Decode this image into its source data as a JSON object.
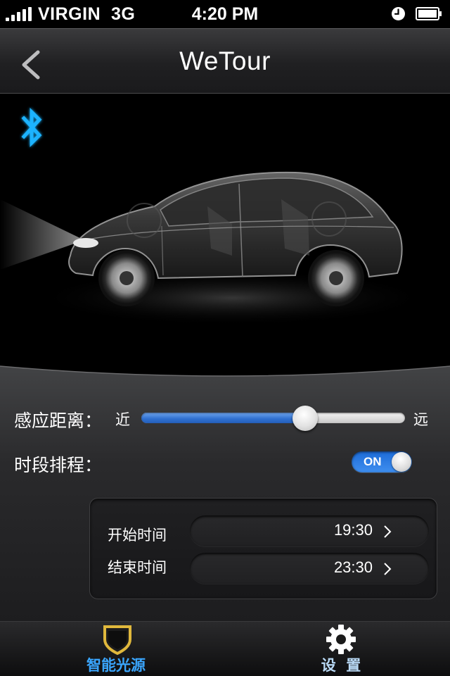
{
  "status_bar": {
    "carrier": "VIRGIN  3G",
    "time": "4:20 PM"
  },
  "nav": {
    "title": "WeTour",
    "back_icon": "chevron-left-icon"
  },
  "bluetooth_icon": "bluetooth-icon",
  "controls": {
    "sensing_distance": {
      "label": "感应距离：",
      "min_label": "近",
      "max_label": "远",
      "value_fraction": 0.62
    },
    "schedule": {
      "label": "时段排程：",
      "toggle_text": "ON",
      "enabled": true
    },
    "times": [
      {
        "label": "开始时间",
        "value": "19:30"
      },
      {
        "label": "结束时间",
        "value": "23:30"
      }
    ]
  },
  "tabs": [
    {
      "label": "智能光源",
      "icon": "shield-icon",
      "active": true
    },
    {
      "label": "设  置",
      "icon": "gear-icon",
      "active": false
    }
  ],
  "colors": {
    "accent_blue": "#2e6fcf",
    "tab_active": "#3aa6ff",
    "tab_inactive": "#b9d9f5",
    "bluetooth": "#1ab3ff",
    "shield_gold": "#e0b83c"
  }
}
